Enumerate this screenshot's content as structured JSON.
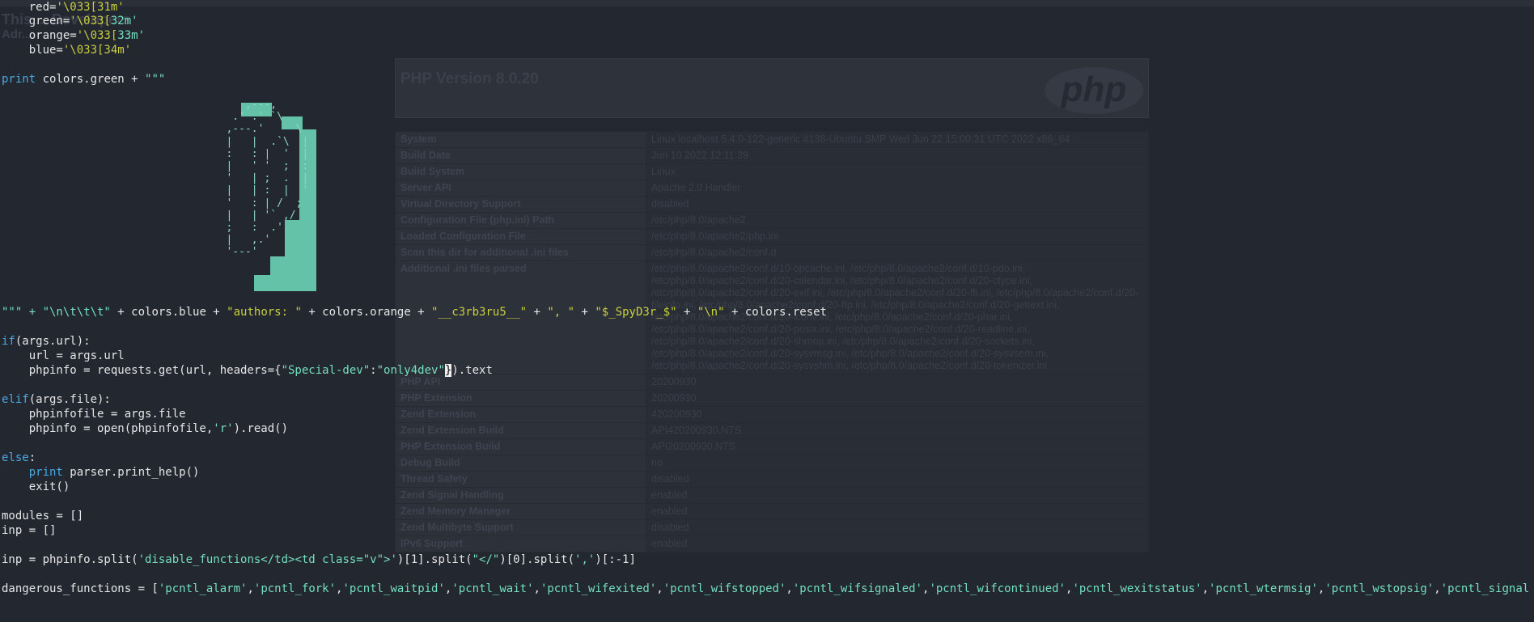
{
  "bg_page": {
    "heading_line_1": "This ... Developers",
    "heading_line_2": "Adr...",
    "php_title": "PHP Version 8.0.20",
    "php_logo": "php",
    "rows": [
      {
        "k": "System",
        "v": "Linux localhost 5.4.0-122-generic #138-Ubuntu SMP Wed Jun 22 15:00:31 UTC 2022 x86_64"
      },
      {
        "k": "Build Date",
        "v": "Jun 10 2022 12:11:39"
      },
      {
        "k": "Build System",
        "v": "Linux"
      },
      {
        "k": "Server API",
        "v": "Apache 2.0 Handler"
      },
      {
        "k": "Virtual Directory Support",
        "v": "disabled"
      },
      {
        "k": "Configuration File (php.ini) Path",
        "v": "/etc/php/8.0/apache2"
      },
      {
        "k": "Loaded Configuration File",
        "v": "/etc/php/8.0/apache2/php.ini"
      },
      {
        "k": "Scan this dir for additional .ini files",
        "v": "/etc/php/8.0/apache2/conf.d"
      },
      {
        "k": "Additional .ini files parsed",
        "v": "/etc/php/8.0/apache2/conf.d/10-opcache.ini, /etc/php/8.0/apache2/conf.d/10-pdo.ini, /etc/php/8.0/apache2/conf.d/20-calendar.ini, /etc/php/8.0/apache2/conf.d/20-ctype.ini, /etc/php/8.0/apache2/conf.d/20-exif.ini, /etc/php/8.0/apache2/conf.d/20-ffi.ini, /etc/php/8.0/apache2/conf.d/20-fileinfo.ini, /etc/php/8.0/apache2/conf.d/20-ftp.ini, /etc/php/8.0/apache2/conf.d/20-gettext.ini, /etc/php/8.0/apache2/conf.d/20-iconv.ini, /etc/php/8.0/apache2/conf.d/20-phar.ini, /etc/php/8.0/apache2/conf.d/20-posix.ini, /etc/php/8.0/apache2/conf.d/20-readline.ini, /etc/php/8.0/apache2/conf.d/20-shmop.ini, /etc/php/8.0/apache2/conf.d/20-sockets.ini, /etc/php/8.0/apache2/conf.d/20-sysvmsg.ini, /etc/php/8.0/apache2/conf.d/20-sysvsem.ini, /etc/php/8.0/apache2/conf.d/20-sysvshm.ini, /etc/php/8.0/apache2/conf.d/20-tokenizer.ini"
      },
      {
        "k": "PHP API",
        "v": "20200930"
      },
      {
        "k": "PHP Extension",
        "v": "20200930"
      },
      {
        "k": "Zend Extension",
        "v": "420200930"
      },
      {
        "k": "Zend Extension Build",
        "v": "API420200930,NTS"
      },
      {
        "k": "PHP Extension Build",
        "v": "API20200930,NTS"
      },
      {
        "k": "Debug Build",
        "v": "no"
      },
      {
        "k": "Thread Safety",
        "v": "disabled"
      },
      {
        "k": "Zend Signal Handling",
        "v": "enabled"
      },
      {
        "k": "Zend Memory Manager",
        "v": "enabled"
      },
      {
        "k": "Zend Multibyte Support",
        "v": "disabled"
      },
      {
        "k": "IPv6 Support",
        "v": "enabled"
      }
    ]
  },
  "code": {
    "l_red_a": "    red=",
    "l_red_b": "'\\033[31m'",
    "l_green_a": "    green=",
    "l_green_b": "'\\033[",
    "l_green_c": "32m'",
    "l_orange_a": "    orange=",
    "l_orange_b": "'\\033[",
    "l_orange_c": "33m'",
    "l_blue_a": "    blue=",
    "l_blue_b": "'\\033[34m'",
    "l_print_kw": "print",
    "l_print_rest": " colors.green + ",
    "l_print_str": "\"\"\"",
    "l_banner": [
      {
        "t": "\"\"\" + ",
        "c": "str"
      },
      {
        "t": "\"\\n\\t\\t\\t\"",
        "c": "str"
      },
      {
        "t": " + colors.blue + ",
        "c": ""
      },
      {
        "t": "\"authors: \"",
        "c": "ylw"
      },
      {
        "t": " + colors.orange + ",
        "c": ""
      },
      {
        "t": "\"__c3rb3ru5__\"",
        "c": "ylw"
      },
      {
        "t": " + ",
        "c": ""
      },
      {
        "t": "\", \"",
        "c": "ylw"
      },
      {
        "t": " + ",
        "c": ""
      },
      {
        "t": "\"$_SpyD3r_$\"",
        "c": "ylw"
      },
      {
        "t": " + ",
        "c": ""
      },
      {
        "t": "\"\\n\"",
        "c": "ylw"
      },
      {
        "t": " + colors.reset",
        "c": ""
      }
    ],
    "l_if_kw": "if",
    "l_if_rest": "(args.url):",
    "l_url": "    url = args.url",
    "l_req_a": "    phpinfo = requests.get(url, headers={",
    "l_req_k": "\"Special-dev\"",
    "l_req_colon": ":",
    "l_req_v": "\"only4dev\"",
    "l_req_cursor": "}",
    "l_req_end": ").text",
    "l_elif_kw": "elif",
    "l_elif_rest": "(args.file):",
    "l_pfile": "    phpinfofile = args.file",
    "l_open_a": "    phpinfo = open(phpinfofile,",
    "l_open_s": "'r'",
    "l_open_b": ").read()",
    "l_else_kw": "else",
    "l_else_rest": ":",
    "l_help_kw": "    print",
    "l_help_rest": " parser.print_help()",
    "l_exit": "    exit()",
    "l_modules": "modules = []",
    "l_inp": "inp = []",
    "l_split_a": "inp = phpinfo.split(",
    "l_split_s1": "'disable_functions</td><td class=\"v\">'",
    "l_split_b": ")[1].split(",
    "l_split_s2": "\"</\"",
    "l_split_c": ")[0].split(",
    "l_split_s3": "','",
    "l_split_d": ")[:-1]",
    "l_danger_a": "dangerous_functions = [",
    "l_danger_items": [
      "'pcntl_alarm'",
      "'pcntl_fork'",
      "'pcntl_waitpid'",
      "'pcntl_wait'",
      "'pcntl_wifexited'",
      "'pcntl_wifstopped'",
      "'pcntl_wifsignaled'",
      "'pcntl_wifcontinued'",
      "'pcntl_wexitstatus'",
      "'pcntl_wtermsig'",
      "'pcntl_wstopsig'",
      "'pcntl_signal'",
      "'pcntl_si"
    ],
    "l_danger_cursor": ">"
  },
  "ascii_art": "      ,---,\n    .' .' `\\\n   ,---.'     \\\n   |   |  .`\\  |\n   :   : |  '  |\n   |   ' '  ;  :\n   '   | ;  .  |\n   |   | :  |  '\n   '   : | /  ;\n   |   | '` ,/\n   ;   :  .'\n   |   ,.'\n   '---'"
}
